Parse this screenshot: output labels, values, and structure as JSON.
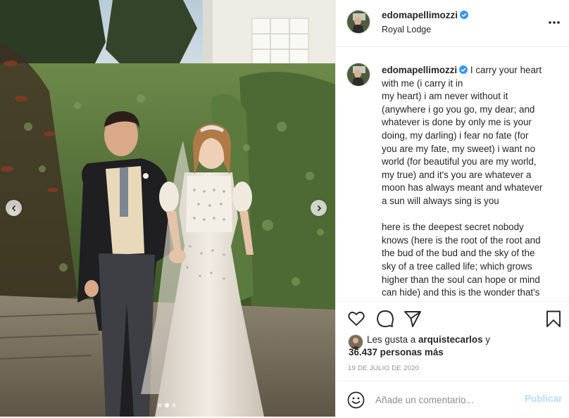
{
  "post": {
    "username": "edomapellimozzi",
    "location": "Royal Lodge",
    "caption_user": "edomapellimozzi",
    "caption_text": " I carry your heart\nwith me (i carry it in\nmy heart) i am never without it\n(anywhere i go you go, my dear; and\nwhatever is done by only me is your\ndoing, my darling) i fear no fate (for\nyou are my fate, my sweet) i want no\nworld (for beautiful you are my world,\nmy true) and it's you are whatever a\nmoon has always meant and whatever\na sun will always sing is you\n\nhere is the deepest secret nobody\nknows (here is the root of the root and\nthe bud of the bud and the sky of the\nsky of a tree called life; which grows\nhigher than the soul can hope or mind\ncan hide) and this is the wonder that's\nkeeping the stars apart",
    "likes_prefix": "Les gusta a ",
    "likes_user": "arquistecarlos",
    "likes_suffix": " y",
    "likes_count": "36.437 personas más",
    "date": "19 DE JULIO DE 2020",
    "carousel_total": 3,
    "carousel_active": 2
  },
  "comment": {
    "placeholder": "Añade un comentario...",
    "publish_label": "Publicar"
  },
  "icons": {
    "more": "more-options-icon",
    "like": "heart-icon",
    "comment": "comment-bubble-icon",
    "share": "paper-plane-icon",
    "save": "bookmark-icon",
    "emoji": "emoji-icon",
    "verified": "verified-badge-icon",
    "prev": "chevron-left-icon",
    "next": "chevron-right-icon"
  },
  "colors": {
    "verified": "#3897f0",
    "publish_disabled": "#b2dffc",
    "secondary_text": "#8e8e8e",
    "divider": "#efefef"
  }
}
